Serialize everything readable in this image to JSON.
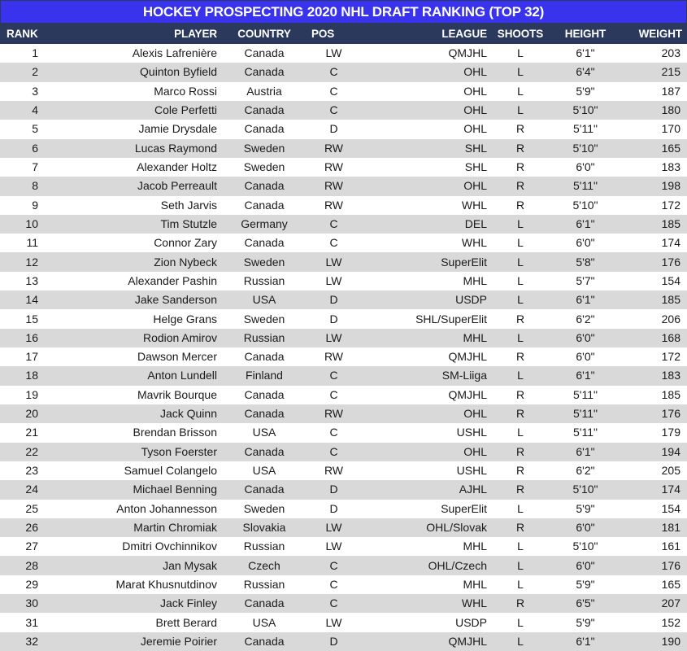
{
  "title": "HOCKEY PROSPECTING 2020 NHL DRAFT RANKING (TOP 32)",
  "colors": {
    "title_bar": "#3a33ee",
    "header_row": "#2b3a5c",
    "row_alt": "#d9d9d9",
    "row_base": "#ffffff",
    "text": "#1a1a1a",
    "header_text": "#ffffff"
  },
  "columns": [
    {
      "key": "rank",
      "label": "RANK"
    },
    {
      "key": "player",
      "label": "PLAYER"
    },
    {
      "key": "country",
      "label": "COUNTRY"
    },
    {
      "key": "pos",
      "label": "POS"
    },
    {
      "key": "league",
      "label": "LEAGUE"
    },
    {
      "key": "shoots",
      "label": "SHOOTS"
    },
    {
      "key": "height",
      "label": "HEIGHT"
    },
    {
      "key": "weight",
      "label": "WEIGHT"
    }
  ],
  "rows": [
    {
      "rank": "1",
      "player": "Alexis Lafrenière",
      "country": "Canada",
      "pos": "LW",
      "league": "QMJHL",
      "shoots": "L",
      "height": "6'1\"",
      "weight": "203"
    },
    {
      "rank": "2",
      "player": "Quinton Byfield",
      "country": "Canada",
      "pos": "C",
      "league": "OHL",
      "shoots": "L",
      "height": "6'4\"",
      "weight": "215"
    },
    {
      "rank": "3",
      "player": "Marco Rossi",
      "country": "Austria",
      "pos": "C",
      "league": "OHL",
      "shoots": "L",
      "height": "5'9\"",
      "weight": "187"
    },
    {
      "rank": "4",
      "player": "Cole Perfetti",
      "country": "Canada",
      "pos": "C",
      "league": "OHL",
      "shoots": "L",
      "height": "5'10\"",
      "weight": "180"
    },
    {
      "rank": "5",
      "player": "Jamie Drysdale",
      "country": "Canada",
      "pos": "D",
      "league": "OHL",
      "shoots": "R",
      "height": "5'11\"",
      "weight": "170"
    },
    {
      "rank": "6",
      "player": "Lucas Raymond",
      "country": "Sweden",
      "pos": "RW",
      "league": "SHL",
      "shoots": "R",
      "height": "5'10\"",
      "weight": "165"
    },
    {
      "rank": "7",
      "player": "Alexander Holtz",
      "country": "Sweden",
      "pos": "RW",
      "league": "SHL",
      "shoots": "R",
      "height": "6'0\"",
      "weight": "183"
    },
    {
      "rank": "8",
      "player": "Jacob Perreault",
      "country": "Canada",
      "pos": "RW",
      "league": "OHL",
      "shoots": "R",
      "height": "5'11\"",
      "weight": "198"
    },
    {
      "rank": "9",
      "player": "Seth Jarvis",
      "country": "Canada",
      "pos": "RW",
      "league": "WHL",
      "shoots": "R",
      "height": "5'10\"",
      "weight": "172"
    },
    {
      "rank": "10",
      "player": "Tim Stutzle",
      "country": "Germany",
      "pos": "C",
      "league": "DEL",
      "shoots": "L",
      "height": "6'1\"",
      "weight": "185"
    },
    {
      "rank": "11",
      "player": "Connor Zary",
      "country": "Canada",
      "pos": "C",
      "league": "WHL",
      "shoots": "L",
      "height": "6'0\"",
      "weight": "174"
    },
    {
      "rank": "12",
      "player": "Zion Nybeck",
      "country": "Sweden",
      "pos": "LW",
      "league": "SuperElit",
      "shoots": "L",
      "height": "5'8\"",
      "weight": "176"
    },
    {
      "rank": "13",
      "player": "Alexander Pashin",
      "country": "Russian",
      "pos": "LW",
      "league": "MHL",
      "shoots": "L",
      "height": "5'7\"",
      "weight": "154"
    },
    {
      "rank": "14",
      "player": "Jake Sanderson",
      "country": "USA",
      "pos": "D",
      "league": "USDP",
      "shoots": "L",
      "height": "6'1\"",
      "weight": "185"
    },
    {
      "rank": "15",
      "player": "Helge Grans",
      "country": "Sweden",
      "pos": "D",
      "league": "SHL/SuperElit",
      "shoots": "R",
      "height": "6'2\"",
      "weight": "206"
    },
    {
      "rank": "16",
      "player": "Rodion Amirov",
      "country": "Russian",
      "pos": "LW",
      "league": "MHL",
      "shoots": "L",
      "height": "6'0\"",
      "weight": "168"
    },
    {
      "rank": "17",
      "player": "Dawson Mercer",
      "country": "Canada",
      "pos": "RW",
      "league": "QMJHL",
      "shoots": "R",
      "height": "6'0\"",
      "weight": "172"
    },
    {
      "rank": "18",
      "player": "Anton Lundell",
      "country": "Finland",
      "pos": "C",
      "league": "SM-Liiga",
      "shoots": "L",
      "height": "6'1\"",
      "weight": "183"
    },
    {
      "rank": "19",
      "player": "Mavrik Bourque",
      "country": "Canada",
      "pos": "C",
      "league": "QMJHL",
      "shoots": "R",
      "height": "5'11\"",
      "weight": "185"
    },
    {
      "rank": "20",
      "player": "Jack Quinn",
      "country": "Canada",
      "pos": "RW",
      "league": "OHL",
      "shoots": "R",
      "height": "5'11\"",
      "weight": "176"
    },
    {
      "rank": "21",
      "player": "Brendan Brisson",
      "country": "USA",
      "pos": "C",
      "league": "USHL",
      "shoots": "L",
      "height": "5'11\"",
      "weight": "179"
    },
    {
      "rank": "22",
      "player": "Tyson Foerster",
      "country": "Canada",
      "pos": "C",
      "league": "OHL",
      "shoots": "R",
      "height": "6'1\"",
      "weight": "194"
    },
    {
      "rank": "23",
      "player": "Samuel Colangelo",
      "country": "USA",
      "pos": "RW",
      "league": "USHL",
      "shoots": "R",
      "height": "6'2\"",
      "weight": "205"
    },
    {
      "rank": "24",
      "player": "Michael Benning",
      "country": "Canada",
      "pos": "D",
      "league": "AJHL",
      "shoots": "R",
      "height": "5'10\"",
      "weight": "174"
    },
    {
      "rank": "25",
      "player": "Anton Johannesson",
      "country": "Sweden",
      "pos": "D",
      "league": "SuperElit",
      "shoots": "L",
      "height": "5'9\"",
      "weight": "154"
    },
    {
      "rank": "26",
      "player": "Martin Chromiak",
      "country": "Slovakia",
      "pos": "LW",
      "league": "OHL/Slovak",
      "shoots": "R",
      "height": "6'0\"",
      "weight": "181"
    },
    {
      "rank": "27",
      "player": "Dmitri Ovchinnikov",
      "country": "Russian",
      "pos": "LW",
      "league": "MHL",
      "shoots": "L",
      "height": "5'10\"",
      "weight": "161"
    },
    {
      "rank": "28",
      "player": "Jan Mysak",
      "country": "Czech",
      "pos": "C",
      "league": "OHL/Czech",
      "shoots": "L",
      "height": "6'0\"",
      "weight": "176"
    },
    {
      "rank": "29",
      "player": "Marat Khusnutdinov",
      "country": "Russian",
      "pos": "C",
      "league": "MHL",
      "shoots": "L",
      "height": "5'9\"",
      "weight": "165"
    },
    {
      "rank": "30",
      "player": "Jack Finley",
      "country": "Canada",
      "pos": "C",
      "league": "WHL",
      "shoots": "R",
      "height": "6'5\"",
      "weight": "207"
    },
    {
      "rank": "31",
      "player": "Brett Berard",
      "country": "USA",
      "pos": "LW",
      "league": "USDP",
      "shoots": "L",
      "height": "5'9\"",
      "weight": "152"
    },
    {
      "rank": "32",
      "player": "Jeremie Poirier",
      "country": "Canada",
      "pos": "D",
      "league": "QMJHL",
      "shoots": "L",
      "height": "6'1\"",
      "weight": "190"
    }
  ]
}
